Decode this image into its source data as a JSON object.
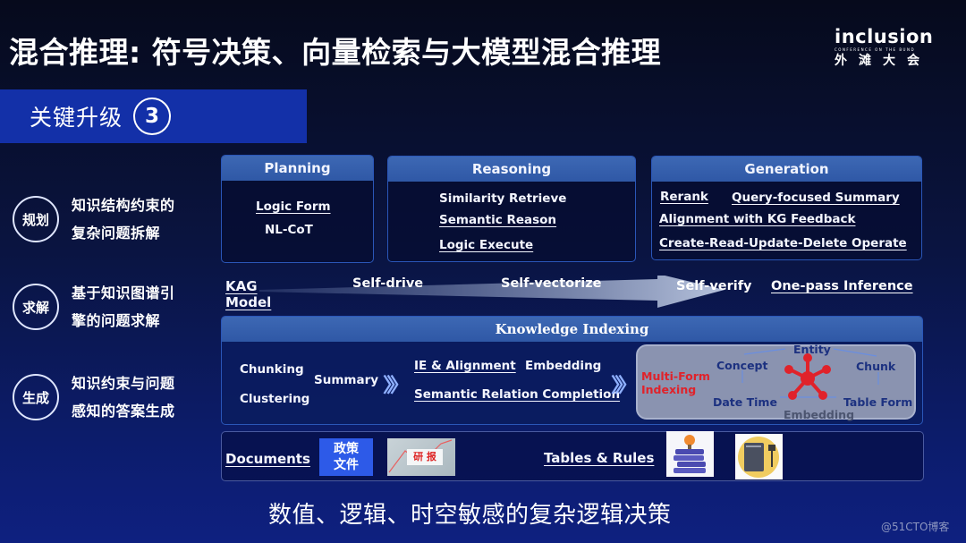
{
  "slide": {
    "title": "混合推理: 符号决策、向量检索与大模型混合推理",
    "logo": {
      "main": "inclusion",
      "sub": "CONFERENCE ON THE BUND",
      "cn": "外滩大会"
    },
    "banner": {
      "label": "关键升级",
      "number": "3"
    },
    "stages": [
      {
        "badge": "规划",
        "desc_line1": "知识结构约束的",
        "desc_line2": "复杂问题拆解"
      },
      {
        "badge": "求解",
        "desc_line1": "基于知识图谱引",
        "desc_line2": "擎的问题求解"
      },
      {
        "badge": "生成",
        "desc_line1": "知识约束与问题",
        "desc_line2": "感知的答案生成"
      }
    ],
    "panels": {
      "planning": {
        "title": "Planning",
        "items": [
          "Logic Form",
          "NL-CoT"
        ]
      },
      "reasoning": {
        "title": "Reasoning",
        "items": [
          "Similarity Retrieve",
          "Semantic Reason",
          "Logic Execute"
        ]
      },
      "generation": {
        "title": "Generation",
        "items": [
          "Rerank",
          "Query-focused Summary",
          "Alignment with KG Feedback",
          "Create-Read-Update-Delete Operate"
        ]
      }
    },
    "flow": {
      "model_line1": "KAG",
      "model_line2": "Model",
      "steps": [
        "Self-drive",
        "Self-vectorize",
        "Self-verify",
        "One-pass Inference"
      ]
    },
    "knowledge_indexing": {
      "title": "Knowledge Indexing",
      "stage1": [
        "Chunking",
        "Clustering"
      ],
      "stage1b": "Summary",
      "stage2": [
        "IE & Alignment",
        "Embedding",
        "Semantic Relation Completion"
      ],
      "multi_form": {
        "label_line1": "Multi-Form",
        "label_line2": "Indexing",
        "nodes": [
          "Entity",
          "Concept",
          "Chunk",
          "Date Time",
          "Table Form",
          "Embedding"
        ]
      }
    },
    "sources": {
      "documents_label": "Documents",
      "policy_line1": "政策",
      "policy_line2": "文件",
      "report_tag": "研 报",
      "tables_label": "Tables & Rules"
    },
    "footer": "数值、逻辑、时空敏感的复杂逻辑决策",
    "watermark": "@51CTO博客",
    "colors": {
      "banner": "#1330a8",
      "panel_header": "#3560ad",
      "multi_form_bg": "#8a93b0",
      "multi_form_label": "#e0222a",
      "graph_node": "#e0222a"
    }
  }
}
